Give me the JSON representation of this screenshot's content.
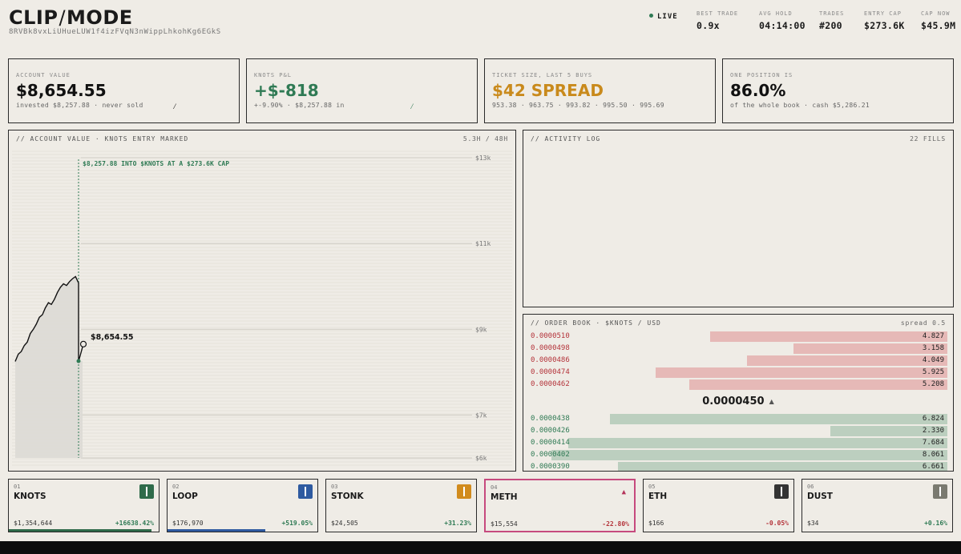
{
  "header": {
    "brand_left": "CLIP",
    "brand_slash": "/",
    "brand_right": "MODE",
    "address": "8RVBk8vxLiUHueLUW1f4izFVqN3nWippLhkohKg6EGkS",
    "live": "LIVE",
    "stats": [
      {
        "label": "BEST TRADE",
        "value": "0.9x"
      },
      {
        "label": "AVG HOLD",
        "value": "04:14:00"
      },
      {
        "label": "TRADES",
        "value": "#200"
      },
      {
        "label": "ENTRY CAP",
        "value": "$273.6K"
      },
      {
        "label": "CAP NOW",
        "value": "$45.9M"
      }
    ]
  },
  "kpis": [
    {
      "label": "ACCOUNT VALUE",
      "value": "$8,654.55",
      "sub": "invested $8,257.88 · never sold",
      "color": "#111111"
    },
    {
      "label": "KNOTS P&L",
      "value": "+$-818",
      "sub": "+-9.90%  ·  $8,257.88 in",
      "color": "#2f7a54"
    },
    {
      "label": "TICKET SIZE, LAST 5 BUYS",
      "value": "$42 SPREAD",
      "sub": "953.38 · 963.75 · 993.82 · 995.50 · 995.69",
      "color": "#c98a1c"
    },
    {
      "label": "ONE POSITION IS",
      "value": "86.0%",
      "sub": "of the whole book · cash $5,286.21",
      "color": "#111111"
    }
  ],
  "chart_panel": {
    "title": "// ACCOUNT VALUE · KNOTS ENTRY MARKED",
    "range": "5.3H / 48H",
    "annotation": "$8,257.88 INTO $KNOTS AT A $273.6K CAP",
    "current_label": "$8,654.55"
  },
  "chart_data": {
    "type": "line",
    "title": "// ACCOUNT VALUE · KNOTS ENTRY MARKED",
    "ylabel": "",
    "ylim": [
      6000,
      13000
    ],
    "y_ticks": [
      "$13k",
      "$11k",
      "$9k",
      "$7k",
      "$6k"
    ],
    "series": [
      {
        "values": [
          8250,
          8420,
          8480,
          8620,
          8700,
          8900,
          9000,
          9120,
          9280,
          9340,
          9500,
          9620,
          9580,
          9700,
          9860,
          9980,
          10060,
          10020,
          10110,
          10180,
          10230,
          10080,
          8250,
          8654.55
        ]
      }
    ],
    "entry_value": 8257.88,
    "current_value": 8654.55
  },
  "activity": {
    "title": "// ACTIVITY LOG",
    "count": "22 FILLS"
  },
  "orderbook": {
    "title": "// ORDER BOOK · $KNOTS / USD",
    "spread": "spread 0.5",
    "asks": [
      {
        "price": "0.0000510",
        "size": "4.827",
        "depth": 0.57
      },
      {
        "price": "0.0000498",
        "size": "3.158",
        "depth": 0.37
      },
      {
        "price": "0.0000486",
        "size": "4.049",
        "depth": 0.48
      },
      {
        "price": "0.0000474",
        "size": "5.925",
        "depth": 0.7
      },
      {
        "price": "0.0000462",
        "size": "5.208",
        "depth": 0.62
      }
    ],
    "mid": "0.0000450",
    "mid_arrow": "▲",
    "bids": [
      {
        "price": "0.0000438",
        "size": "6.824",
        "depth": 0.81
      },
      {
        "price": "0.0000426",
        "size": "2.330",
        "depth": 0.28
      },
      {
        "price": "0.0000414",
        "size": "7.684",
        "depth": 0.91
      },
      {
        "price": "0.0000402",
        "size": "8.061",
        "depth": 0.95
      },
      {
        "price": "0.0000390",
        "size": "6.661",
        "depth": 0.79
      }
    ]
  },
  "tiles": [
    {
      "num": "01",
      "name": "KNOTS",
      "price": "$1,354,644",
      "change": "+16638.42%",
      "change_color": "#2f7a54",
      "icon_color": "#2f6b4a",
      "icon": "bar-icon",
      "progress": 0.95,
      "progress_color": "#2f6b4a",
      "active": false
    },
    {
      "num": "02",
      "name": "LOOP",
      "price": "$176,970",
      "change": "+519.05%",
      "change_color": "#2f7a54",
      "icon_color": "#2e5aa0",
      "icon": "bar-icon",
      "progress": 0.65,
      "progress_color": "#2e5aa0",
      "active": false
    },
    {
      "num": "03",
      "name": "STONK",
      "price": "$24,505",
      "change": "+31.23%",
      "change_color": "#2f7a54",
      "icon_color": "#d18b1d",
      "icon": "bar-icon",
      "progress": 0,
      "progress_color": "#d18b1d",
      "active": false
    },
    {
      "num": "04",
      "name": "METH",
      "price": "$15,554",
      "change": "-22.80%",
      "change_color": "#b4333a",
      "icon_color": "#c64a7e",
      "icon": "triangle-icon",
      "progress": 0,
      "progress_color": "#c64a7e",
      "active": true
    },
    {
      "num": "05",
      "name": "ETH",
      "price": "$166",
      "change": "-0.05%",
      "change_color": "#b4333a",
      "icon_color": "#333333",
      "icon": "bar-icon",
      "progress": 0,
      "progress_color": "#333333",
      "active": false
    },
    {
      "num": "06",
      "name": "DUST",
      "price": "$34",
      "change": "+0.16%",
      "change_color": "#2f7a54",
      "icon_color": "#7a7a70",
      "icon": "bar-icon",
      "progress": 0,
      "progress_color": "#7a7a70",
      "active": false
    }
  ]
}
